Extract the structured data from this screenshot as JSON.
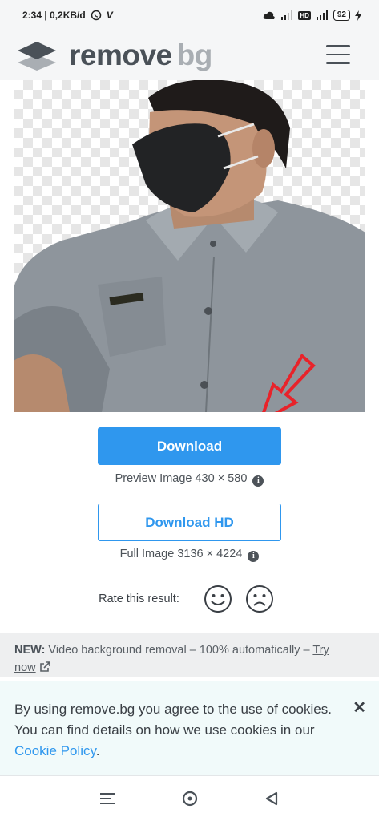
{
  "status_bar": {
    "time_speed": "2:34 | 0,2KB/d",
    "v_glyph": "V",
    "battery": "92",
    "hd": "HD"
  },
  "header": {
    "logo_remove": "remove",
    "logo_bg": "bg"
  },
  "actions": {
    "download_label": "Download",
    "preview_info": "Preview Image 430 × 580",
    "download_hd_label": "Download HD",
    "full_info": "Full Image 3136 × 4224",
    "info_icon": "i"
  },
  "rating": {
    "label": "Rate this result:"
  },
  "banner": {
    "new_label": "NEW:",
    "text": " Video background removal – 100% automatically – ",
    "try_label": "Try",
    "now_label": "now"
  },
  "cookie": {
    "text": "By using remove.bg you agree to the use of cookies. You can find details on how we use cookies in our ",
    "link": "Cookie Policy",
    "tail": ".",
    "close": "✕"
  },
  "colors": {
    "accent": "#2f97ee",
    "annotation_arrow": "#e8232a"
  }
}
